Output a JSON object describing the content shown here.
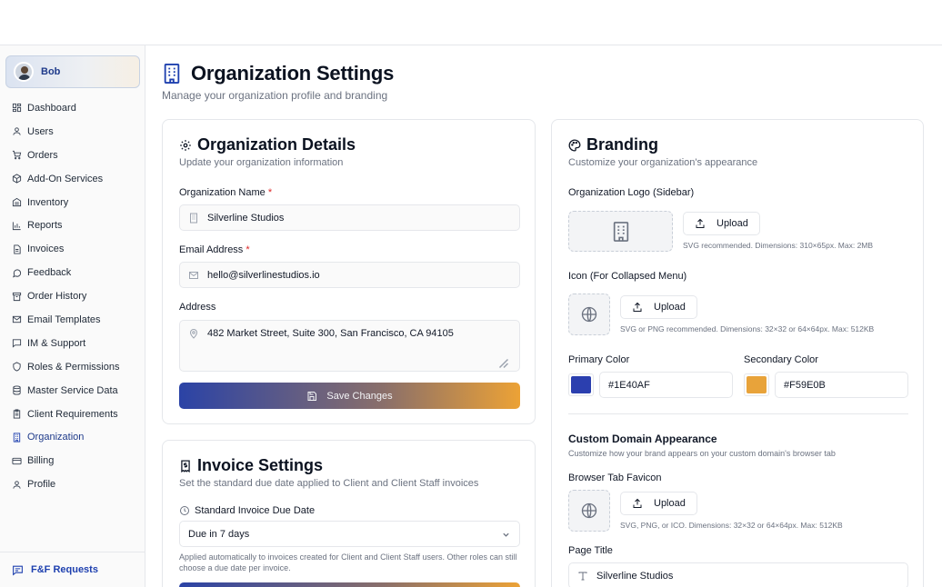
{
  "user": {
    "name": "Bob"
  },
  "sidebar": {
    "items": [
      {
        "label": "Dashboard",
        "icon": "dashboard-icon"
      },
      {
        "label": "Users",
        "icon": "user-icon"
      },
      {
        "label": "Orders",
        "icon": "cart-icon"
      },
      {
        "label": "Add-On Services",
        "icon": "box-icon"
      },
      {
        "label": "Inventory",
        "icon": "warehouse-icon"
      },
      {
        "label": "Reports",
        "icon": "bar-chart-icon"
      },
      {
        "label": "Invoices",
        "icon": "file-icon"
      },
      {
        "label": "Feedback",
        "icon": "message-circle-icon"
      },
      {
        "label": "Order History",
        "icon": "archive-icon"
      },
      {
        "label": "Email Templates",
        "icon": "mail-icon"
      },
      {
        "label": "IM & Support",
        "icon": "message-square-icon"
      },
      {
        "label": "Roles & Permissions",
        "icon": "shield-icon"
      },
      {
        "label": "Master Service Data",
        "icon": "database-icon"
      },
      {
        "label": "Client Requirements",
        "icon": "clipboard-icon"
      },
      {
        "label": "Organization",
        "icon": "building-icon"
      },
      {
        "label": "Billing",
        "icon": "credit-card-icon"
      },
      {
        "label": "Profile",
        "icon": "user-icon"
      }
    ],
    "active": "Organization",
    "footer_label": "F&F Requests"
  },
  "page": {
    "title": "Organization Settings",
    "subtitle": "Manage your organization profile and branding"
  },
  "org_details": {
    "title": "Organization Details",
    "subtitle": "Update your organization information",
    "name_label": "Organization Name",
    "name_value": "Silverline Studios",
    "email_label": "Email Address",
    "email_value": "hello@silverlinestudios.io",
    "address_label": "Address",
    "address_value": "482 Market Street, Suite 300, San Francisco, CA 94105",
    "required_mark": "*",
    "save_label": "Save Changes"
  },
  "invoice": {
    "title": "Invoice Settings",
    "subtitle": "Set the standard due date applied to Client and Client Staff invoices",
    "due_label": "Standard Invoice Due Date",
    "due_value": "Due in 7 days",
    "note": "Applied automatically to invoices created for Client and Client Staff users. Other roles can still choose a due date per invoice."
  },
  "branding": {
    "title": "Branding",
    "subtitle": "Customize your organization's appearance",
    "logo_label": "Organization Logo (Sidebar)",
    "logo_hint": "SVG recommended. Dimensions: 310×65px. Max: 2MB",
    "icon_label": "Icon (For Collapsed Menu)",
    "icon_hint": "SVG or PNG recommended. Dimensions: 32×32 or 64×64px. Max: 512KB",
    "upload_label": "Upload",
    "primary_label": "Primary Color",
    "primary_value": "#1E40AF",
    "primary_color": "#2b3faf",
    "secondary_label": "Secondary Color",
    "secondary_value": "#F59E0B",
    "secondary_color": "#e8a33a",
    "domain_title": "Custom Domain Appearance",
    "domain_subtitle": "Customize how your brand appears on your custom domain's browser tab",
    "favicon_label": "Browser Tab Favicon",
    "favicon_hint": "SVG, PNG, or ICO. Dimensions: 32×32 or 64×64px. Max: 512KB",
    "page_title_label": "Page Title",
    "page_title_value": "Silverline Studios"
  }
}
